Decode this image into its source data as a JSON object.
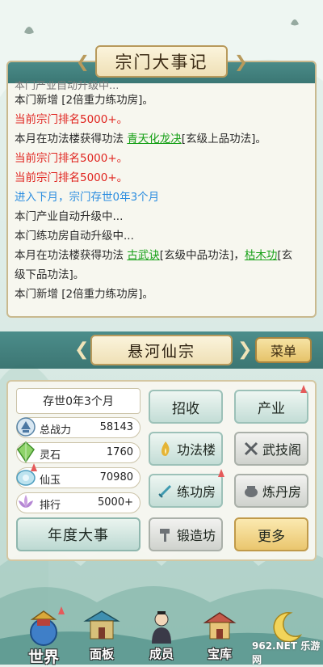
{
  "chronicle": {
    "title": "宗门大事记",
    "clipped_line": "本门产业自动升级中...",
    "lines": [
      {
        "type": "plain",
        "text": "本门新增 [2倍重力练功房]。"
      },
      {
        "type": "red",
        "text": "当前宗门排名5000+。"
      },
      {
        "type": "plain",
        "parts": [
          {
            "t": "本月在功法楼获得功法 "
          },
          {
            "t": "青天化龙决",
            "g": true
          },
          {
            "t": "[玄级上品功法]。"
          }
        ]
      },
      {
        "type": "red",
        "text": "当前宗门排名5000+。"
      },
      {
        "type": "red",
        "text": "当前宗门排名5000+。"
      },
      {
        "type": "blue",
        "text": "进入下月，宗门存世0年3个月"
      },
      {
        "type": "plain",
        "text": "本门产业自动升级中..."
      },
      {
        "type": "plain",
        "text": "本门练功房自动升级中..."
      },
      {
        "type": "plain",
        "wrap": true,
        "parts": [
          {
            "t": "本月在功法楼获得功法 "
          },
          {
            "t": "古武诀",
            "g": true
          },
          {
            "t": "[玄级中品功法]，"
          },
          {
            "t": "枯木功",
            "g": true
          },
          {
            "t": "[玄级下品功法]。"
          }
        ]
      },
      {
        "type": "plain",
        "text": "本门新增 [2倍重力练功房]。"
      }
    ]
  },
  "sect": {
    "name": "悬河仙宗",
    "menu_label": "菜单"
  },
  "status": {
    "age": "存世0年3个月",
    "stats": [
      {
        "label": "总战力",
        "value": "58143"
      },
      {
        "label": "灵石",
        "value": "1760"
      },
      {
        "label": "仙玉",
        "value": "70980"
      },
      {
        "label": "排行",
        "value": "5000+"
      }
    ],
    "year_events_label": "年度大事"
  },
  "actions": {
    "recruit": "招收",
    "industry": "产业",
    "skill_hall": "功法楼",
    "martial_pavilion": "武技阁",
    "training_room": "练功房",
    "alchemy_room": "炼丹房",
    "forge": "锻造坊",
    "more": "更多"
  },
  "nav": {
    "world": "世界",
    "panel": "面板",
    "members": "成员",
    "treasury": "宝库"
  },
  "watermark": "962.NET 乐游网"
}
